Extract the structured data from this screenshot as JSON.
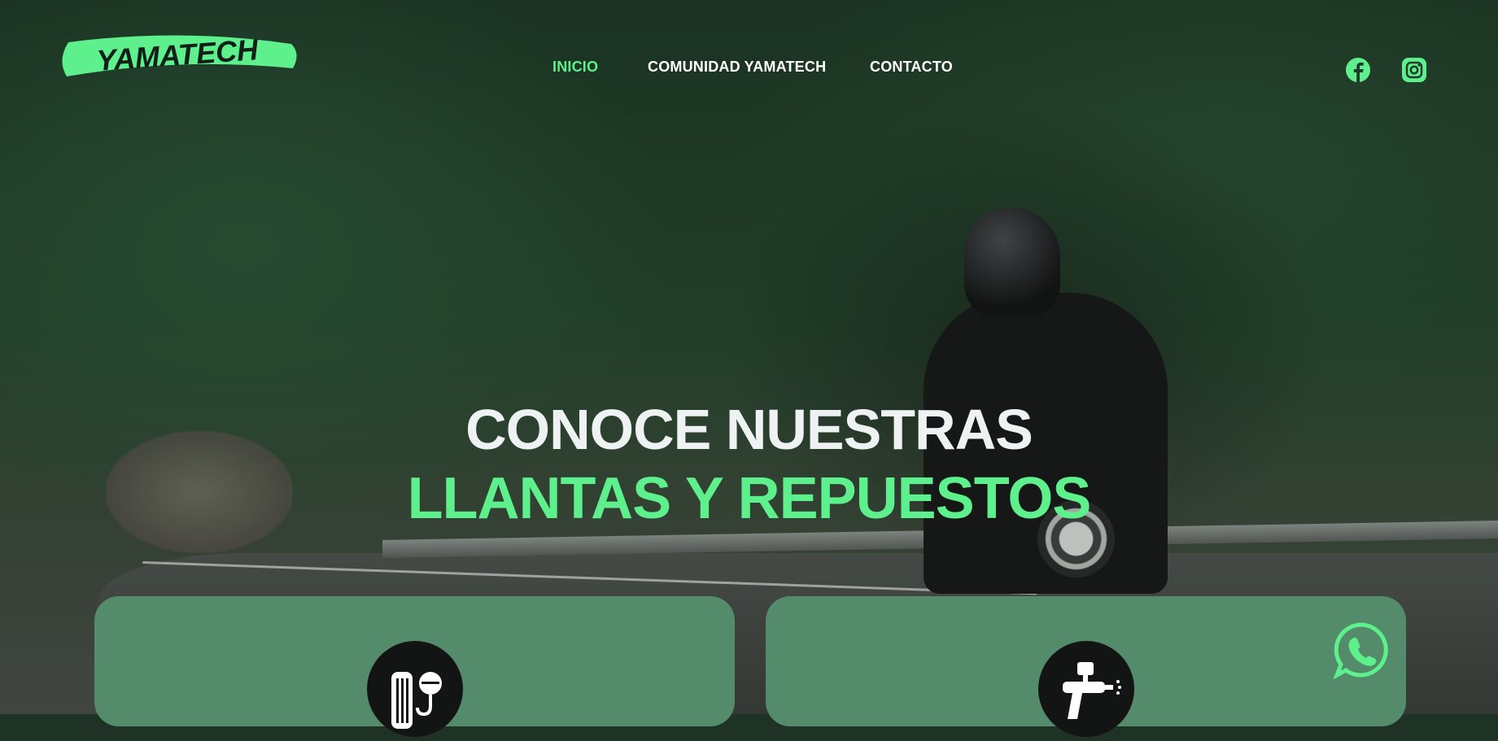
{
  "brand": {
    "logo_text": "YAMATECH",
    "accent_color": "#5ef08c"
  },
  "nav": {
    "items": [
      {
        "label": "INICIO",
        "active": true
      },
      {
        "label": "COMUNIDAD YAMATECH",
        "active": false
      },
      {
        "label": "CONTACTO",
        "active": false
      }
    ]
  },
  "social": {
    "icons": [
      "facebook-icon",
      "instagram-icon"
    ]
  },
  "hero": {
    "line1": "CONOCE NUESTRAS",
    "line2": "LLANTAS Y REPUESTOS"
  },
  "cards": [
    {
      "icon": "tire-gauge-icon"
    },
    {
      "icon": "spray-gun-icon"
    }
  ],
  "floating": {
    "icon": "whatsapp-icon"
  }
}
